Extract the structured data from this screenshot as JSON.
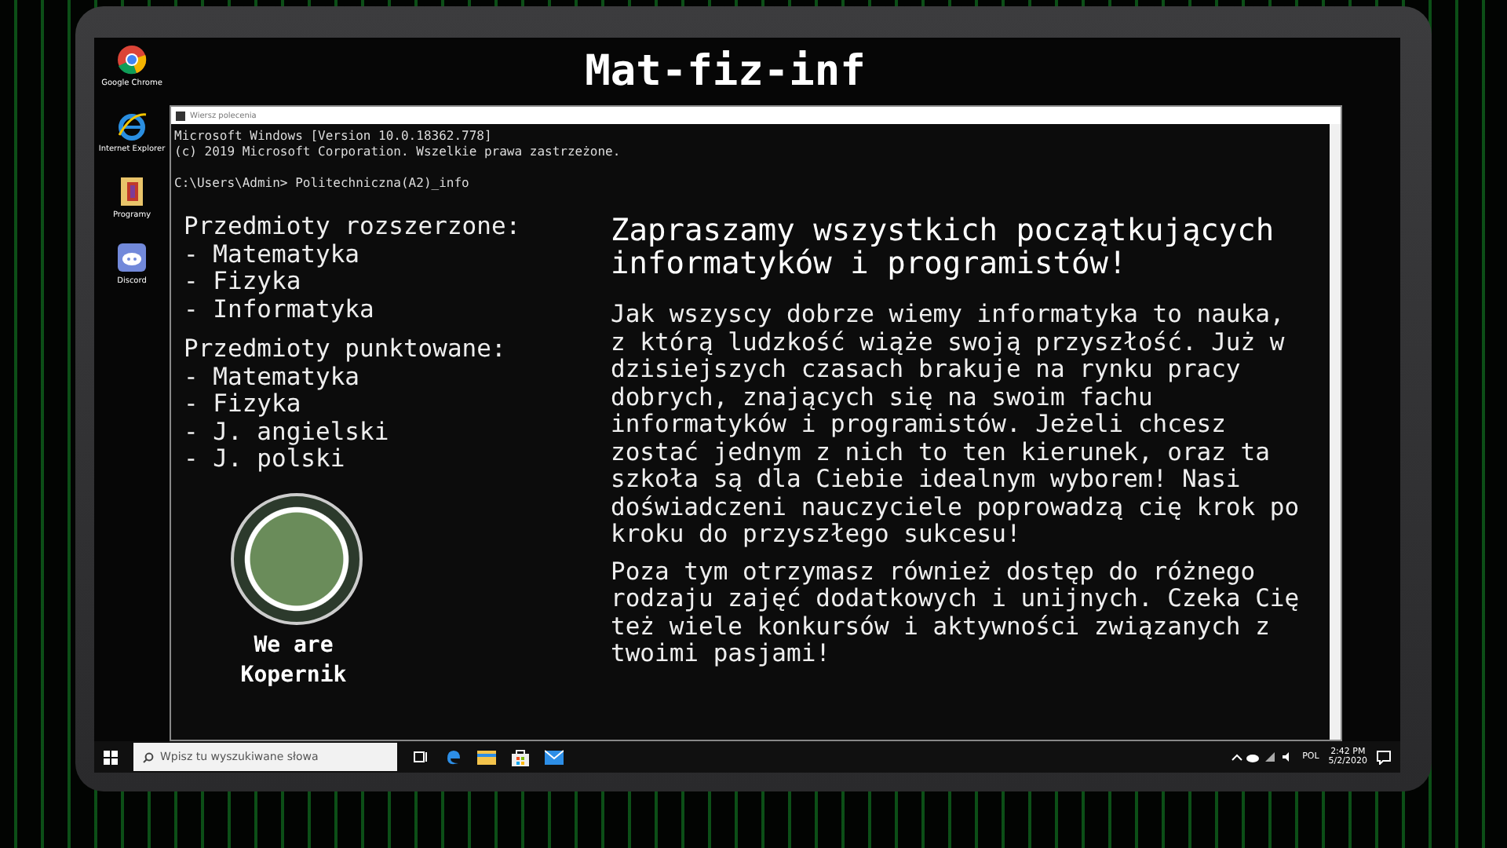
{
  "banner": {
    "title": "Mat-fiz-inf"
  },
  "desktop_icons": [
    {
      "label": "Google Chrome",
      "kind": "chrome"
    },
    {
      "label": "Internet Explorer",
      "kind": "ie"
    },
    {
      "label": "Programy",
      "kind": "folder"
    },
    {
      "label": "Discord",
      "kind": "discord"
    }
  ],
  "console": {
    "title": "Wiersz polecenia",
    "header_lines": [
      "Microsoft Windows [Version 10.0.18362.778]",
      "(c) 2019 Microsoft Corporation. Wszelkie prawa zastrzeżone."
    ],
    "prompt": "C:\\Users\\Admin> Politechniczna(A2)_info",
    "subject_groups": [
      {
        "heading": "Przedmioty rozszerzone:",
        "items": [
          "- Matematyka",
          "- Fizyka",
          "- Informatyka"
        ]
      },
      {
        "heading": "Przedmioty punktowane:",
        "items": [
          "- Matematyka",
          "- Fizyka",
          "- J. angielski",
          "- J. polski"
        ]
      }
    ],
    "logo_caption": "We are\nKopernik",
    "headline": "Zapraszamy wszystkich początkujących informatyków i programistów!",
    "paragraphs": [
      "Jak wszyscy dobrze wiemy informatyka to nauka, z którą ludzkość wiąże swoją przyszłość. Już w dzisiejszych czasach brakuje na rynku pracy dobrych, znających się na swoim fachu informatyków i programistów. Jeżeli chcesz zostać jednym z nich to ten kierunek, oraz ta szkoła są dla Ciebie idealnym wyborem! Nasi doświadczeni nauczyciele poprowadzą cię krok po kroku do przyszłego sukcesu!",
      "Poza tym otrzymasz również dostęp do różnego rodzaju zajęć dodatkowych i unijnych. Czeka Cię też wiele konkursów i aktywności związanych z twoimi pasjami!"
    ]
  },
  "taskbar": {
    "search_placeholder": "Wpisz tu wyszukiwane słowa",
    "apps": [
      {
        "kind": "taskview"
      },
      {
        "kind": "edge"
      },
      {
        "kind": "explorer"
      },
      {
        "kind": "store"
      },
      {
        "kind": "mail"
      }
    ],
    "language": "POL",
    "time": "2:42 PM",
    "date": "5/2/2020"
  }
}
